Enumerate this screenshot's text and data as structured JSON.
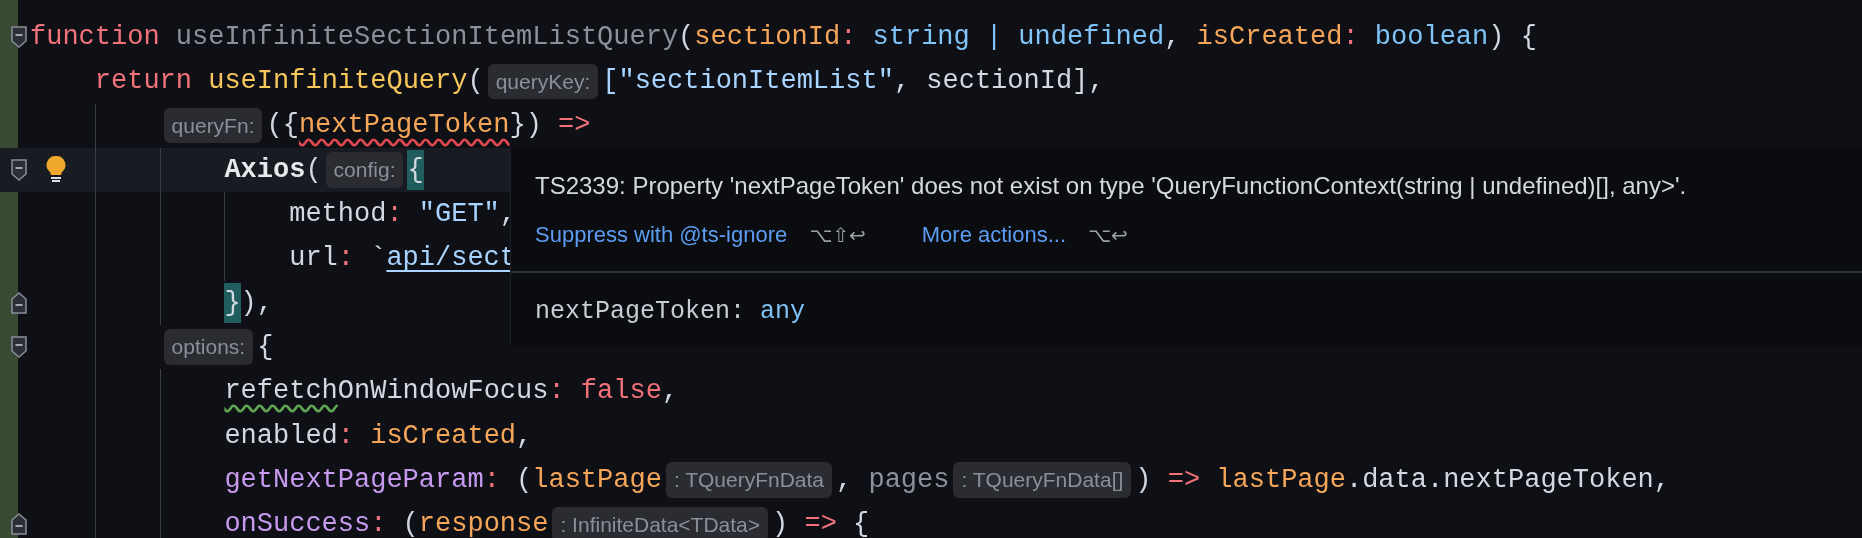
{
  "editor": {
    "lines": [
      {
        "fold_start": true,
        "tokens": [
          {
            "text": "function",
            "kind": "keyword"
          },
          {
            "text": " useInfiniteSectionItemListQuery",
            "kind": "unused"
          },
          {
            "text": "(",
            "kind": "plain"
          },
          {
            "text": "sectionId",
            "kind": "param"
          },
          {
            "text": ":",
            "kind": "punct"
          },
          {
            "text": " string | undefined",
            "kind": "type"
          },
          {
            "text": ", ",
            "kind": "plain"
          },
          {
            "text": "isCreated",
            "kind": "param"
          },
          {
            "text": ":",
            "kind": "punct"
          },
          {
            "text": " boolean",
            "kind": "type"
          },
          {
            "text": ") {",
            "kind": "plain"
          }
        ],
        "children": [
          {
            "tokens": [
              {
                "text": "return",
                "kind": "keyword"
              },
              {
                "text": " useInfiniteQuery",
                "kind": "function"
              },
              {
                "text": "(",
                "kind": "plain"
              },
              {
                "text": "queryKey:",
                "kind": "hint"
              },
              {
                "text": "[\"sectionItemList\"",
                "kind": "string"
              },
              {
                "text": ", sectionId],",
                "kind": "plain"
              }
            ],
            "children": [
              {
                "tokens": [
                  {
                    "text": "queryFn:",
                    "kind": "hint"
                  },
                  {
                    "text": "({",
                    "kind": "plain"
                  },
                  {
                    "text": "nextPageToken",
                    "kind": "param",
                    "error": true
                  },
                  {
                    "text": "})",
                    "kind": "plain"
                  },
                  {
                    "text": " =>",
                    "kind": "punct"
                  }
                ],
                "children": [
                  {
                    "fold_start": true,
                    "current": true,
                    "bulb": true,
                    "tokens": [
                      {
                        "text": "Axios",
                        "kind": "bold"
                      },
                      {
                        "text": "(",
                        "kind": "plain"
                      },
                      {
                        "text": "config:",
                        "kind": "hint"
                      },
                      {
                        "text": "{",
                        "kind": "plain",
                        "matched": true
                      }
                    ],
                    "children": [
                      {
                        "tokens": [
                          {
                            "text": "method",
                            "kind": "plain"
                          },
                          {
                            "text": ":",
                            "kind": "punct"
                          },
                          {
                            "text": " \"GET\"",
                            "kind": "string"
                          },
                          {
                            "text": ",",
                            "kind": "plain"
                          }
                        ]
                      },
                      {
                        "tokens": [
                          {
                            "text": "url",
                            "kind": "plain"
                          },
                          {
                            "text": ":",
                            "kind": "punct"
                          },
                          {
                            "text": " `",
                            "kind": "plain"
                          },
                          {
                            "text": "api/sect",
                            "kind": "string",
                            "link": true
                          }
                        ]
                      }
                    ]
                  },
                  {
                    "fold_end": true,
                    "tokens": [
                      {
                        "text": "}",
                        "kind": "plain",
                        "matched": true
                      },
                      {
                        "text": "),",
                        "kind": "plain"
                      }
                    ]
                  }
                ]
              },
              {
                "fold_start": true,
                "tokens": [
                  {
                    "text": "options:",
                    "kind": "hint"
                  },
                  {
                    "text": "{",
                    "kind": "plain"
                  }
                ],
                "children": [
                  {
                    "tokens": [
                      {
                        "text": "refetch",
                        "kind": "plain",
                        "warning": true
                      },
                      {
                        "text": "OnWindowFocus",
                        "kind": "plain"
                      },
                      {
                        "text": ":",
                        "kind": "punct"
                      },
                      {
                        "text": " false",
                        "kind": "keyword"
                      },
                      {
                        "text": ",",
                        "kind": "plain"
                      }
                    ]
                  },
                  {
                    "tokens": [
                      {
                        "text": "enabled",
                        "kind": "plain"
                      },
                      {
                        "text": ":",
                        "kind": "punct"
                      },
                      {
                        "text": " isCreated",
                        "kind": "param"
                      },
                      {
                        "text": ",",
                        "kind": "plain"
                      }
                    ]
                  },
                  {
                    "tokens": [
                      {
                        "text": "getNextPageParam",
                        "kind": "property"
                      },
                      {
                        "text": ":",
                        "kind": "punct"
                      },
                      {
                        "text": " (",
                        "kind": "plain"
                      },
                      {
                        "text": "lastPage",
                        "kind": "param"
                      },
                      {
                        "text": ": TQueryFnData",
                        "kind": "hint"
                      },
                      {
                        "text": ", ",
                        "kind": "plain"
                      },
                      {
                        "text": "pages",
                        "kind": "unused"
                      },
                      {
                        "text": ": TQueryFnData[]",
                        "kind": "hint"
                      },
                      {
                        "text": ")",
                        "kind": "plain"
                      },
                      {
                        "text": " =>",
                        "kind": "punct"
                      },
                      {
                        "text": " lastPage",
                        "kind": "param"
                      },
                      {
                        "text": ".data.nextPageToken,",
                        "kind": "plain"
                      }
                    ]
                  },
                  {
                    "fold_end": true,
                    "tokens": [
                      {
                        "text": "onSuccess",
                        "kind": "property"
                      },
                      {
                        "text": ":",
                        "kind": "punct"
                      },
                      {
                        "text": " (",
                        "kind": "plain"
                      },
                      {
                        "text": "response",
                        "kind": "param"
                      },
                      {
                        "text": ": InfiniteData<TData>",
                        "kind": "hint"
                      },
                      {
                        "text": ")",
                        "kind": "plain"
                      },
                      {
                        "text": " =>",
                        "kind": "punct"
                      },
                      {
                        "text": " {",
                        "kind": "plain"
                      }
                    ]
                  }
                ]
              }
            ]
          }
        ]
      }
    ]
  },
  "tooltip": {
    "message": "TS2339: Property 'nextPageToken' does not exist on type 'QueryFunctionContext(string | undefined)[], any>'.",
    "actions": [
      {
        "label": "Suppress with @ts-ignore",
        "shortcut": "⌥⇧↩"
      },
      {
        "label": "More actions...",
        "shortcut": "⌥↩"
      }
    ],
    "signature": [
      {
        "text": "nextPageToken:",
        "kind": "plain"
      },
      {
        "text": " any",
        "kind": "type"
      }
    ]
  }
}
